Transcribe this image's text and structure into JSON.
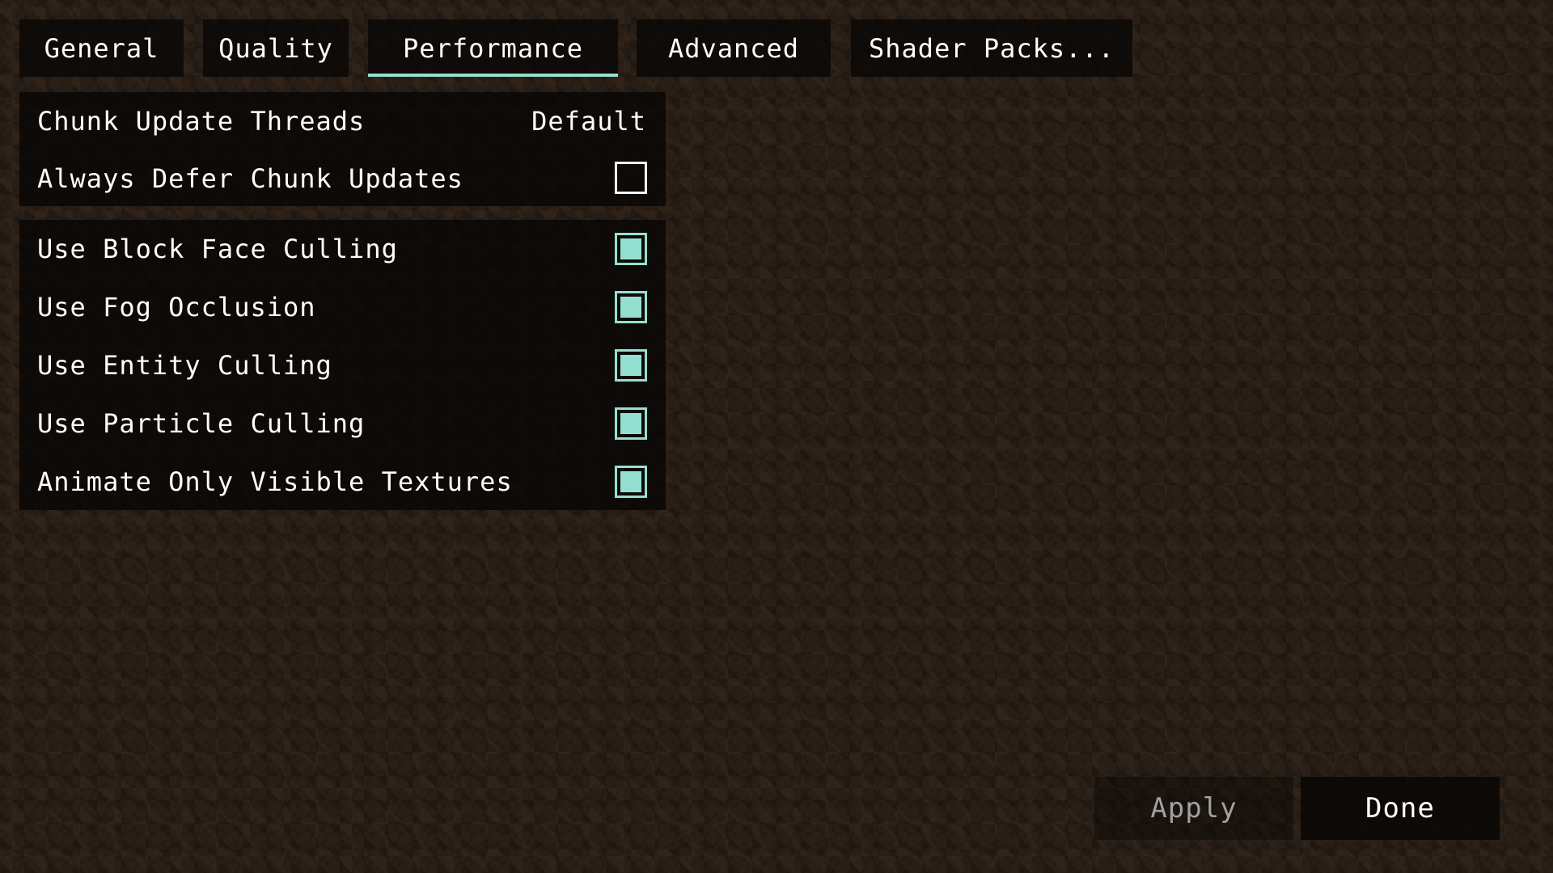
{
  "tabs": [
    {
      "label": "General",
      "active": false
    },
    {
      "label": "Quality",
      "active": false
    },
    {
      "label": "Performance",
      "active": true
    },
    {
      "label": "Advanced",
      "active": false
    },
    {
      "label": "Shader Packs...",
      "active": false
    }
  ],
  "accent_color": "#94e0d0",
  "groups": [
    {
      "options": [
        {
          "label": "Chunk Update Threads",
          "type": "value",
          "value": "Default"
        },
        {
          "label": "Always Defer Chunk Updates",
          "type": "checkbox",
          "checked": false
        }
      ]
    },
    {
      "options": [
        {
          "label": "Use Block Face Culling",
          "type": "checkbox",
          "checked": true
        },
        {
          "label": "Use Fog Occlusion",
          "type": "checkbox",
          "checked": true
        },
        {
          "label": "Use Entity Culling",
          "type": "checkbox",
          "checked": true
        },
        {
          "label": "Use Particle Culling",
          "type": "checkbox",
          "checked": true
        },
        {
          "label": "Animate Only Visible Textures",
          "type": "checkbox",
          "checked": true
        }
      ]
    }
  ],
  "footer": {
    "apply_label": "Apply",
    "apply_enabled": false,
    "done_label": "Done"
  }
}
